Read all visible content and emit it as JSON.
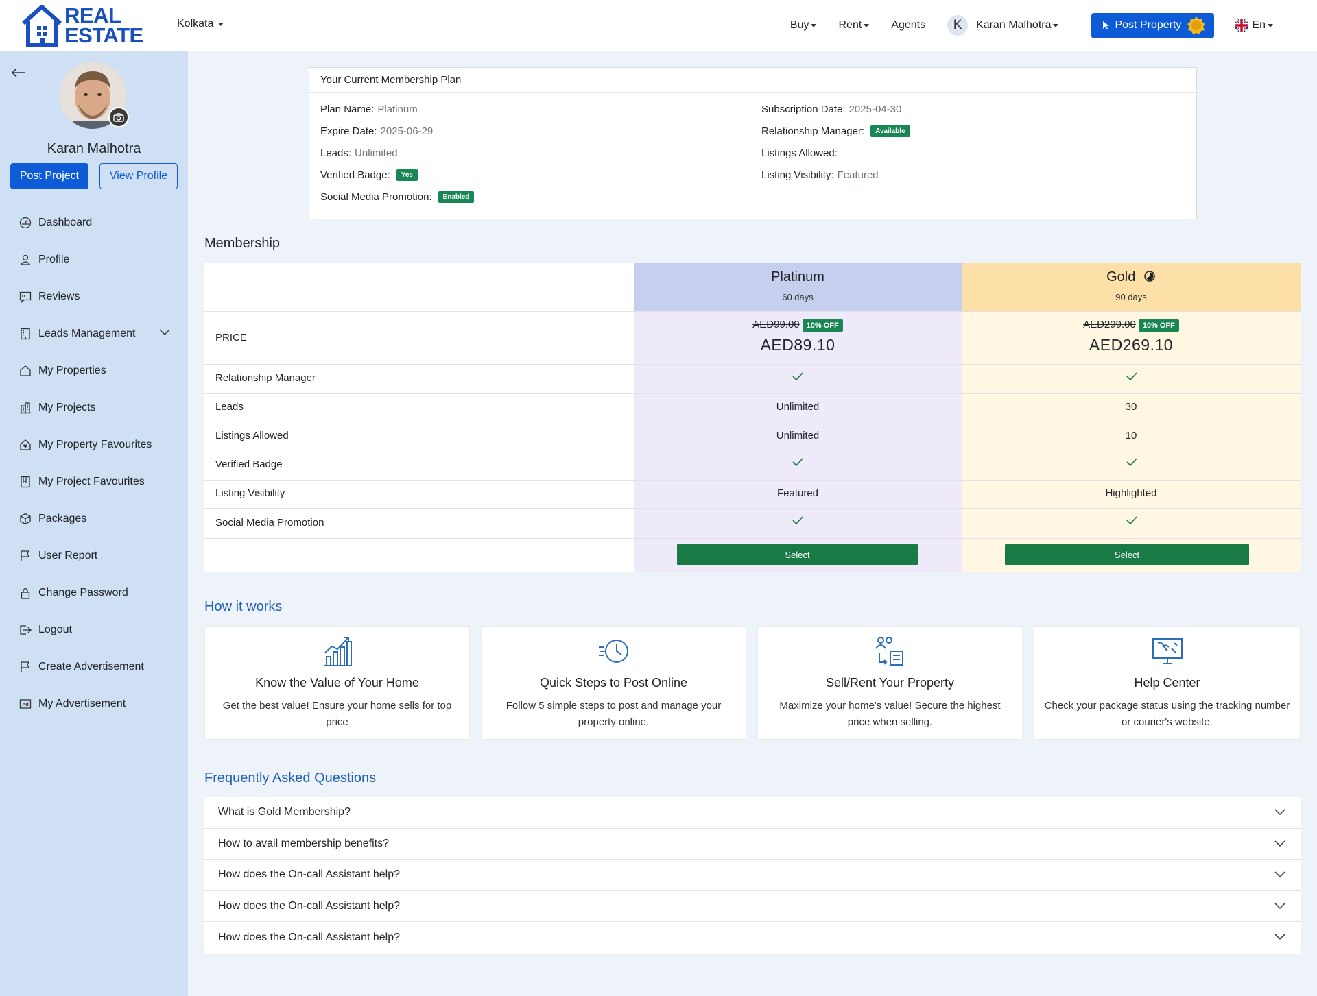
{
  "header": {
    "logo_line1": "REAL",
    "logo_line2": "ESTATE",
    "city": "Kolkata",
    "nav_buy": "Buy",
    "nav_rent": "Rent",
    "nav_agents": "Agents",
    "user_initial": "K",
    "user_name": "Karan Malhotra",
    "post_property": "Post Property",
    "language": "En"
  },
  "sidebar": {
    "name": "Karan Malhotra",
    "post_project": "Post Project",
    "view_profile": "View Profile",
    "items": [
      {
        "label": "Dashboard",
        "icon": "dashboard-icon"
      },
      {
        "label": "Profile",
        "icon": "user-icon"
      },
      {
        "label": "Reviews",
        "icon": "reviews-icon"
      },
      {
        "label": "Leads Management",
        "icon": "building-icon"
      },
      {
        "label": "My Properties",
        "icon": "house-icon"
      },
      {
        "label": "My Projects",
        "icon": "buildings-icon"
      },
      {
        "label": "My Property Favourites",
        "icon": "house-heart-icon"
      },
      {
        "label": "My Project Favourites",
        "icon": "bookmark-icon"
      },
      {
        "label": "Packages",
        "icon": "box-icon"
      },
      {
        "label": "User Report",
        "icon": "flag-icon"
      },
      {
        "label": "Change Password",
        "icon": "lock-icon"
      },
      {
        "label": "Logout",
        "icon": "logout-icon"
      },
      {
        "label": "Create Advertisement",
        "icon": "flag-icon"
      },
      {
        "label": "My Advertisement",
        "icon": "ad-icon"
      }
    ]
  },
  "current_plan": {
    "title": "Your Current Membership Plan",
    "plan_name_label": "Plan Name:",
    "plan_name": "Platinum",
    "expire_label": "Expire Date:",
    "expire": "2025-06-29",
    "leads_label": "Leads:",
    "leads": "Unlimited",
    "verified_label": "Verified Badge:",
    "verified": "Yes",
    "social_label": "Social Media Promotion:",
    "social": "Enabled",
    "sub_date_label": "Subscription Date:",
    "sub_date": "2025-04-30",
    "rm_label": "Relationship Manager:",
    "rm": "Available",
    "listings_label": "Listings Allowed:",
    "visibility_label": "Listing Visibility:",
    "visibility": "Featured"
  },
  "membership": {
    "title": "Membership",
    "price_label": "PRICE",
    "rows": [
      "Relationship Manager",
      "Leads",
      "Listings Allowed",
      "Verified Badge",
      "Listing Visibility",
      "Social Media Promotion"
    ],
    "platinum": {
      "name": "Platinum",
      "days": "60 days",
      "old_price": "AED99.00",
      "discount": "10% OFF",
      "price": "AED89.10",
      "leads": "Unlimited",
      "listings": "Unlimited",
      "visibility": "Featured",
      "select": "Select"
    },
    "gold": {
      "name": "Gold",
      "days": "90 days",
      "old_price": "AED299.00",
      "discount": "10% OFF",
      "price": "AED269.10",
      "leads": "30",
      "listings": "10",
      "visibility": "Highlighted",
      "select": "Select"
    },
    "colors": {
      "platinum_head": "#c6d0ee",
      "gold_head": "#fddfa8",
      "select": "#1a7a45"
    }
  },
  "how_it_works": {
    "title": "How it works",
    "cards": [
      {
        "title": "Know the Value of Your Home",
        "text": "Get the best value! Ensure your home sells for top price",
        "icon": "chart-growth-icon"
      },
      {
        "title": "Quick Steps to Post Online",
        "text": "Follow 5 simple steps to post and manage your property online.",
        "icon": "fast-clock-icon"
      },
      {
        "title": "Sell/Rent Your Property",
        "text": "Maximize your home's value! Secure the highest price when selling.",
        "icon": "exchange-people-icon"
      },
      {
        "title": "Help Center",
        "text": "Check your package status using the tracking number or courier's website.",
        "icon": "monitor-help-icon"
      }
    ]
  },
  "faq": {
    "title": "Frequently Asked Questions",
    "items": [
      "What is Gold Membership?",
      "How to avail membership benefits?",
      "How does the On-call Assistant help?",
      "How does the On-call Assistant help?",
      "How does the On-call Assistant help?"
    ]
  }
}
